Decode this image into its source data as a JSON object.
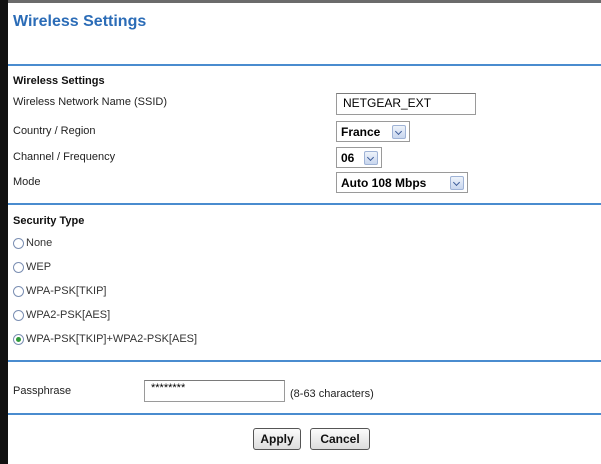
{
  "page": {
    "title": "Wireless Settings"
  },
  "wireless": {
    "section_title": "Wireless Settings",
    "ssid_label": "Wireless Network Name (SSID)",
    "ssid_value": "NETGEAR_EXT",
    "region_label": "Country / Region",
    "region_value": "France",
    "channel_label": "Channel / Frequency",
    "channel_value": "06",
    "mode_label": "Mode",
    "mode_value": "Auto 108 Mbps"
  },
  "security": {
    "section_title": "Security Type",
    "options": [
      {
        "label": "None",
        "checked": false
      },
      {
        "label": "WEP",
        "checked": false
      },
      {
        "label": "WPA-PSK[TKIP]",
        "checked": false
      },
      {
        "label": "WPA2-PSK[AES]",
        "checked": false
      },
      {
        "label": "WPA-PSK[TKIP]+WPA2-PSK[AES]",
        "checked": true
      }
    ]
  },
  "passphrase": {
    "label": "Passphrase",
    "value": "********",
    "hint": "(8-63 characters)"
  },
  "actions": {
    "apply": "Apply",
    "cancel": "Cancel"
  },
  "colors": {
    "title": "#2b6cb7",
    "rule": "#4a8ccf",
    "radio_selected": "#2f9a3a"
  }
}
